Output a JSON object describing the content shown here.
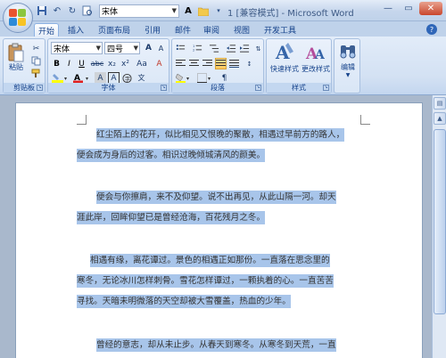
{
  "window": {
    "title": "1 [兼容模式] - Microsoft Word",
    "min": "—",
    "max": "▭",
    "close": "✕"
  },
  "qat": {
    "font_value": "宋体",
    "icons": [
      "save-icon",
      "undo-icon",
      "redo-icon",
      "print-preview-icon",
      "folder-icon",
      "dropdown-icon"
    ]
  },
  "tabs": [
    "开始",
    "插入",
    "页面布局",
    "引用",
    "邮件",
    "审阅",
    "视图",
    "开发工具"
  ],
  "active_tab": "开始",
  "ribbon": {
    "clipboard": {
      "label": "剪贴板",
      "paste": "粘贴"
    },
    "font": {
      "label": "字体",
      "font_name": "宋体",
      "font_size": "四号",
      "grow": "A",
      "shrink": "A",
      "bold": "B",
      "italic": "I",
      "underline": "U",
      "strike": "abc",
      "subscript": "x₂",
      "superscript": "x²",
      "case": "Aa",
      "clear": "A"
    },
    "paragraph": {
      "label": "段落"
    },
    "styles": {
      "label": "样式",
      "quick_styles": "快速样式",
      "change_styles": "更改样式"
    },
    "editing": {
      "label": "编辑"
    }
  },
  "document": {
    "paragraphs": [
      [
        "红尘陌上的花开，似比相见又恨晚的聚散，相遇过早前方的路人，",
        "便会成为身后的过客。相识过晚倾城清风的颜美。"
      ],
      [
        "便会与你擦肩，来不及仰望。说不出再见，从此山隔一河。却天",
        "涯此岸，回眸仰望已是曾经沧海，百花残月之冬。"
      ],
      [
        "相遇有缘，离花谭过。景色的相遇正如那份。一直落在思念里的",
        "寒冬，无论冰川怎样刺骨。雪花怎样谭过，一颗执着的心。一直苦苦",
        "寻找。天暗未明微落的天空却被大雪覆盖，热血的少年。"
      ],
      [
        "曾经的意志，却从未止步。从春天到寒冬。从寒冬到天荒，一直"
      ]
    ]
  }
}
